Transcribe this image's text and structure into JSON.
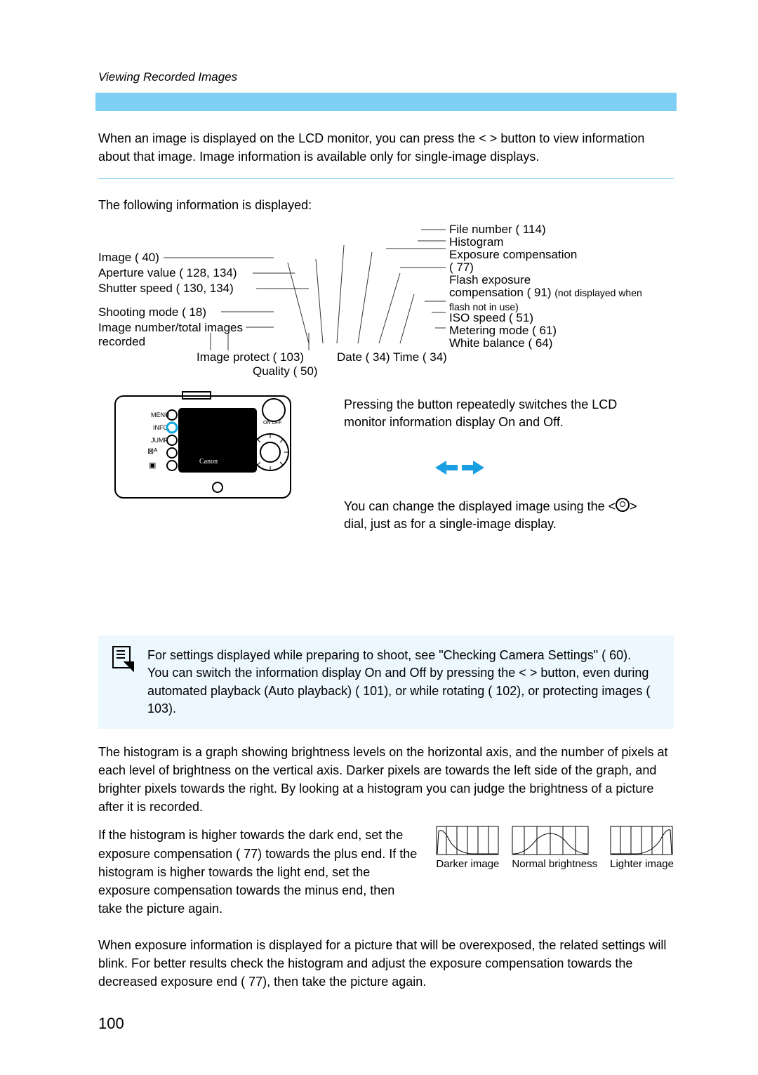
{
  "breadcrumb": "Viewing Recorded Images",
  "intro": "When an image is displayed on the LCD monitor, you can press the <        > button to view information about that image. Image information is available only for single-image displays.",
  "following_info": "The following information is displayed:",
  "labels_left": {
    "image": "Image (   40)",
    "aperture": "Aperture value (   128, 134)",
    "shutter": "Shutter speed (   130, 134)",
    "shooting_mode": "Shooting mode (   18)",
    "imgnum1": "Image number/total images",
    "imgnum2": "recorded",
    "image_protect": "Image protect (   103)",
    "quality": "Quality (   50)",
    "date_time": "Date (   34) Time (   34)"
  },
  "labels_right": {
    "file_number": "File number (   114)",
    "histogram": "Histogram",
    "exp_comp": "Exposure compensation",
    "exp_comp_ref": "(   77)",
    "flash_exp1": "Flash exposure",
    "flash_exp2": "compensation (   91)",
    "flash_note": "(not displayed when flash not in use)",
    "iso": "ISO speed (   51)",
    "metering": "Metering mode (   61)",
    "wb": "White balance (   64)"
  },
  "side1": "Pressing the button repeatedly switches the LCD monitor information display On and Off.",
  "side2_a": "You can change the displayed image using the <",
  "side2_b": "> dial, just as for a single-image display.",
  "note1": "For settings displayed while preparing to shoot, see \"Checking Camera Settings\" (   60).",
  "note2": "You can switch the information display On and Off by pressing the <          > button, even during automated playback (Auto playback) (   101), or while rotating (   102), or protecting images (   103).",
  "hist_para": "The histogram is a graph showing brightness levels on the horizontal axis, and the number of pixels at each level of brightness on the vertical axis. Darker pixels are towards the left side of the graph, and brighter pixels towards the right. By looking at a histogram you can judge the brightness of a picture after it is recorded.",
  "hist_para2": "If the histogram is higher towards the dark end, set the exposure compensation (   77) towards the plus end. If the histogram is higher towards the light end, set the exposure compensation towards the minus end, then take the picture again.",
  "hist_labels": {
    "dark": "Darker image",
    "normal": "Normal brightness",
    "light": "Lighter image"
  },
  "overexp": "When exposure information is displayed for a picture that will be overexposed, the related settings will blink. For better results check the histogram and adjust the exposure compensation towards the decreased exposure end (   77), then take the picture again.",
  "page_number": "100"
}
